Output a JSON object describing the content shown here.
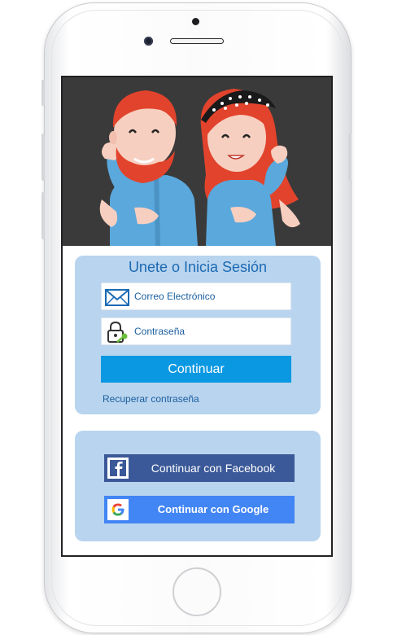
{
  "login": {
    "title": "Unete o Inicia Sesión",
    "email_label": "Correo Electrónico",
    "password_label": "Contraseña",
    "continue_label": "Continuar",
    "recover_label": "Recuperar contraseña"
  },
  "social": {
    "facebook_label": "Continuar con Facebook",
    "google_label": "Continuar con Google"
  },
  "colors": {
    "hero_bg": "#3a3a3a",
    "card_bg": "#b9d4ee",
    "continue_button": "#0b98e2",
    "facebook": "#3b5998",
    "google": "#4285f4",
    "text_link": "#1b5fa0"
  },
  "icons": [
    "envelope-icon",
    "padlock-key-icon",
    "facebook-icon",
    "google-icon"
  ]
}
